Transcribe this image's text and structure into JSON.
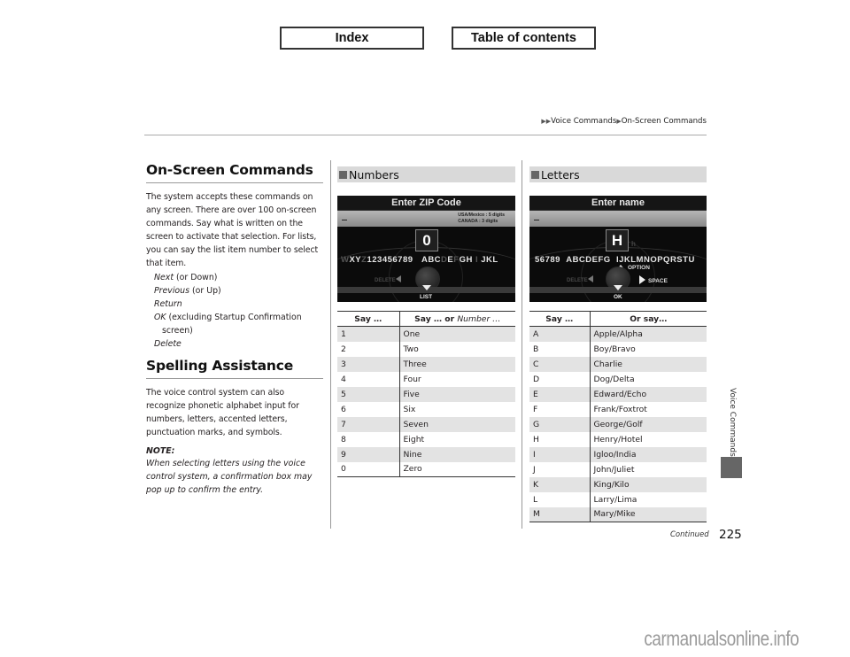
{
  "nav": {
    "index_label": "Index",
    "toc_label": "Table of contents"
  },
  "breadcrumb": {
    "items": [
      "Voice Commands",
      "On-Screen Commands"
    ]
  },
  "left": {
    "title": "On-Screen Commands",
    "intro": "The system accepts these commands on any screen. There are over 100 on-screen commands. Say what is written on the screen to activate that selection. For lists, you can say the list item number to select that item.",
    "commands": [
      {
        "cmd": "Next",
        "note": " (or Down)"
      },
      {
        "cmd": "Previous",
        "note": " (or Up)"
      },
      {
        "cmd": "Return",
        "note": ""
      },
      {
        "cmd": "OK",
        "note": " (excluding Startup Confirmation",
        "wrap": "screen)"
      },
      {
        "cmd": "Delete",
        "note": ""
      }
    ],
    "spelling_title": "Spelling Assistance",
    "spelling_body": "The voice control system can also recognize phonetic alphabet input for numbers, letters, accented letters, punctuation marks, and symbols.",
    "note_title": "NOTE:",
    "note_body": "When selecting letters using the voice control system, a confirmation box may pop up to confirm the entry."
  },
  "numbers": {
    "heading": "Numbers",
    "screen": {
      "title": "Enter ZIP Code",
      "hint_line1": "USA/Mexico : 5 digits",
      "hint_line2": "CANADA : 3 digits",
      "selected": "0",
      "row_left_dim": "W",
      "row_left": "XY",
      "row_left_dim2": "Z",
      "row_digits": "123456789",
      "row_right": "ABC",
      "row_right_dim": "D",
      "row_right2": "E",
      "row_right_dim2": "F",
      "row_right3": "GH",
      "row_right_dim3": "I",
      "row_right4": "JKL",
      "delete_label": "DELETE",
      "bottom_label": "LIST"
    },
    "table": {
      "col1": "Say …",
      "col2_bold": "Say … or ",
      "col2_italic": "Number …",
      "rows": [
        [
          "1",
          "One"
        ],
        [
          "2",
          "Two"
        ],
        [
          "3",
          "Three"
        ],
        [
          "4",
          "Four"
        ],
        [
          "5",
          "Five"
        ],
        [
          "6",
          "Six"
        ],
        [
          "7",
          "Seven"
        ],
        [
          "8",
          "Eight"
        ],
        [
          "9",
          "Nine"
        ],
        [
          "0",
          "Zero"
        ]
      ]
    }
  },
  "letters": {
    "heading": "Letters",
    "screen": {
      "title": "Enter name",
      "selected": "H",
      "selected_dim": "h",
      "row_left": "56789",
      "row_mid": "ABCDEFG",
      "row_right": "IJKLMNOPQRSTU",
      "option_label": "OPTION",
      "space_label": "SPACE",
      "delete_label": "DELETE",
      "bottom_label": "OK"
    },
    "table": {
      "col1": "Say …",
      "col2": "Or say…",
      "rows": [
        [
          "A",
          "Apple/Alpha"
        ],
        [
          "B",
          "Boy/Bravo"
        ],
        [
          "C",
          "Charlie"
        ],
        [
          "D",
          "Dog/Delta"
        ],
        [
          "E",
          "Edward/Echo"
        ],
        [
          "F",
          "Frank/Foxtrot"
        ],
        [
          "G",
          "George/Golf"
        ],
        [
          "H",
          "Henry/Hotel"
        ],
        [
          "I",
          "Igloo/India"
        ],
        [
          "J",
          "John/Juliet"
        ],
        [
          "K",
          "King/Kilo"
        ],
        [
          "L",
          "Larry/Lima"
        ],
        [
          "M",
          "Mary/Mike"
        ]
      ]
    }
  },
  "side_tab": "Voice Commands",
  "footer": {
    "continued": "Continued",
    "page_number": "225",
    "watermark": "carmanualsonline.info"
  }
}
